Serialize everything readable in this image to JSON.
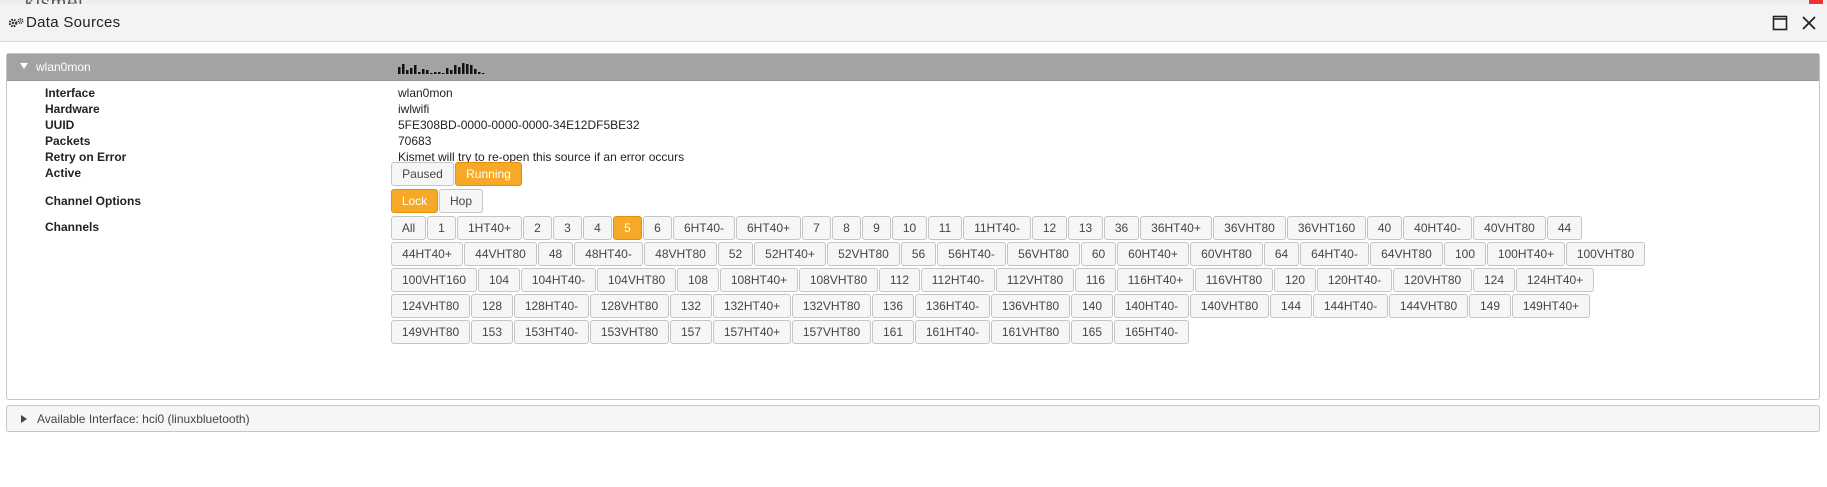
{
  "window": {
    "title": "Data Sources",
    "background_app_name": "kismet"
  },
  "source": {
    "name": "wlan0mon",
    "details": [
      {
        "label": "Interface",
        "value": "wlan0mon"
      },
      {
        "label": "Hardware",
        "value": "iwlwifi"
      },
      {
        "label": "UUID",
        "value": "5FE308BD-0000-0000-0000-34E12DF5BE32"
      },
      {
        "label": "Packets",
        "value": "70683"
      },
      {
        "label": "Retry on Error",
        "value": "Kismet will try to re-open this source if an error occurs"
      }
    ],
    "active": {
      "label": "Active",
      "options": [
        {
          "label": "Paused",
          "selected": false
        },
        {
          "label": "Running",
          "selected": true
        }
      ]
    },
    "channel_options": {
      "label": "Channel Options",
      "options": [
        {
          "label": "Lock",
          "selected": true
        },
        {
          "label": "Hop",
          "selected": false
        }
      ]
    },
    "channels": {
      "label": "Channels",
      "selected": "5",
      "rows": [
        [
          "All",
          "1",
          "1HT40+",
          "2",
          "3",
          "4",
          "5",
          "6",
          "6HT40-",
          "6HT40+",
          "7",
          "8",
          "9",
          "10",
          "11",
          "11HT40-",
          "12",
          "13",
          "36",
          "36HT40+",
          "36VHT80",
          "36VHT160",
          "40",
          "40HT40-",
          "40VHT80",
          "44"
        ],
        [
          "44HT40+",
          "44VHT80",
          "48",
          "48HT40-",
          "48VHT80",
          "52",
          "52HT40+",
          "52VHT80",
          "56",
          "56HT40-",
          "56VHT80",
          "60",
          "60HT40+",
          "60VHT80",
          "64",
          "64HT40-",
          "64VHT80",
          "100",
          "100HT40+",
          "100VHT80"
        ],
        [
          "100VHT160",
          "104",
          "104HT40-",
          "104VHT80",
          "108",
          "108HT40+",
          "108VHT80",
          "112",
          "112HT40-",
          "112VHT80",
          "116",
          "116HT40+",
          "116VHT80",
          "120",
          "120HT40-",
          "120VHT80",
          "124",
          "124HT40+"
        ],
        [
          "124VHT80",
          "128",
          "128HT40-",
          "128VHT80",
          "132",
          "132HT40+",
          "132VHT80",
          "136",
          "136HT40-",
          "136VHT80",
          "140",
          "140HT40-",
          "140VHT80",
          "144",
          "144HT40-",
          "144VHT80",
          "149",
          "149HT40+"
        ],
        [
          "149VHT80",
          "153",
          "153HT40-",
          "153VHT80",
          "157",
          "157HT40+",
          "157VHT80",
          "161",
          "161HT40-",
          "161VHT80",
          "165",
          "165HT40-"
        ]
      ]
    },
    "packet_sparkline": [
      6,
      8,
      3,
      5,
      7,
      2,
      4,
      3,
      1,
      2,
      2,
      1,
      5,
      3,
      7,
      6,
      9,
      8,
      7,
      4,
      2,
      1
    ]
  },
  "available_interface": {
    "label": "Available Interface: hci0 (linuxbluetooth)"
  },
  "colors": {
    "accent": "#f6a828",
    "header_bg": "#a3a3a3"
  }
}
